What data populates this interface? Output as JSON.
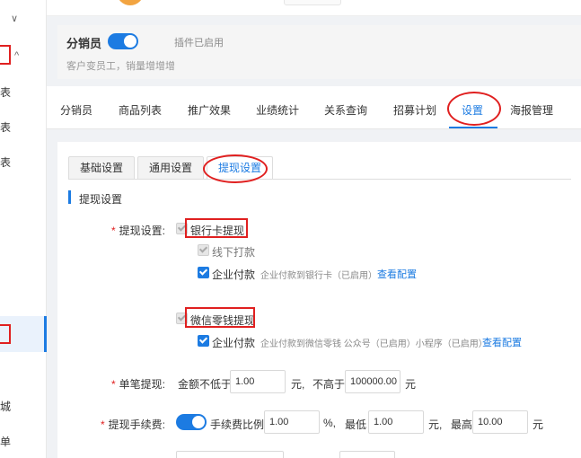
{
  "sidebar": {
    "items": [
      "表",
      "表",
      "表",
      "城",
      "单"
    ]
  },
  "plugin": {
    "name": "分销员",
    "status": "插件已启用",
    "desc": "客户变员工，销量增增增"
  },
  "tabs": [
    "分销员",
    "商品列表",
    "推广效果",
    "业绩统计",
    "关系查询",
    "招募计划",
    "设置",
    "海报管理"
  ],
  "sub_tabs": [
    "基础设置",
    "通用设置",
    "提现设置"
  ],
  "section_title": "提现设置",
  "withdraw": {
    "label": "提现设置:",
    "bank": {
      "name": "银行卡提现",
      "offline": "线下打款",
      "enterprise": "企业付款",
      "enterprise_hint": "企业付款到银行卡（已启用）",
      "config_link": "查看配置"
    },
    "wechat": {
      "name": "微信零钱提现",
      "enterprise": "企业付款",
      "enterprise_hint": "企业付款到微信零钱 公众号（已启用）小程序（已启用）",
      "config_link": "查看配置"
    }
  },
  "single": {
    "label": "单笔提现:",
    "min_label": "金额不低于",
    "min_value": "1.00",
    "unit1": "元,",
    "max_label": "不高于",
    "max_value": "100000.00",
    "unit2": "元"
  },
  "fee": {
    "label": "提现手续费:",
    "ratio_label": "手续费比例",
    "ratio_value": "1.00",
    "pct": "%,",
    "min_label": "最低",
    "min_value": "1.00",
    "unit1": "元,",
    "max_label": "最高",
    "max_value": "10.00",
    "unit2": "元"
  },
  "colors": {
    "accent": "#1c7be2",
    "annotation": "#e02020"
  }
}
